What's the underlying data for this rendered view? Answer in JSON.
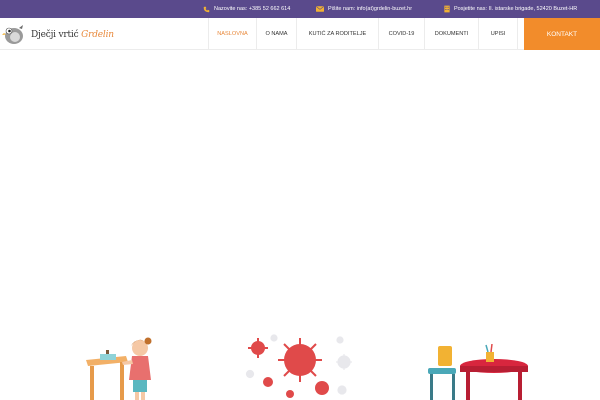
{
  "topbar": {
    "phone": "Nazovite nas: +385 52 662 614",
    "email": "Pišite nam: info(at)grdelin-buzet.hr",
    "address": "Posjetite nas: II. istarske brigade, 52420 Buzet-HR",
    "colors": {
      "background": "#5a4a8c",
      "icon": "#f2b233"
    }
  },
  "logo": {
    "text_main": "Dječji vrtić",
    "text_accent": "Grdelin",
    "icon": "bird-logo-icon"
  },
  "nav": {
    "items": [
      {
        "label": "NASLOVNA",
        "active": true
      },
      {
        "label": "O NAMA",
        "active": false
      },
      {
        "label": "KUTIĆ ZA RODITELJE",
        "active": false
      },
      {
        "label": "COVID-19",
        "active": false
      },
      {
        "label": "DOKUMENTI",
        "active": false
      },
      {
        "label": "UPISI",
        "active": false
      }
    ],
    "contact_label": "KONTAKT",
    "colors": {
      "active": "#e8883a",
      "contact_bg": "#f28c2b"
    }
  },
  "illustrations": [
    {
      "icon": "girl-at-desk-icon"
    },
    {
      "icon": "virus-icon"
    },
    {
      "icon": "kids-table-chair-icon"
    }
  ]
}
